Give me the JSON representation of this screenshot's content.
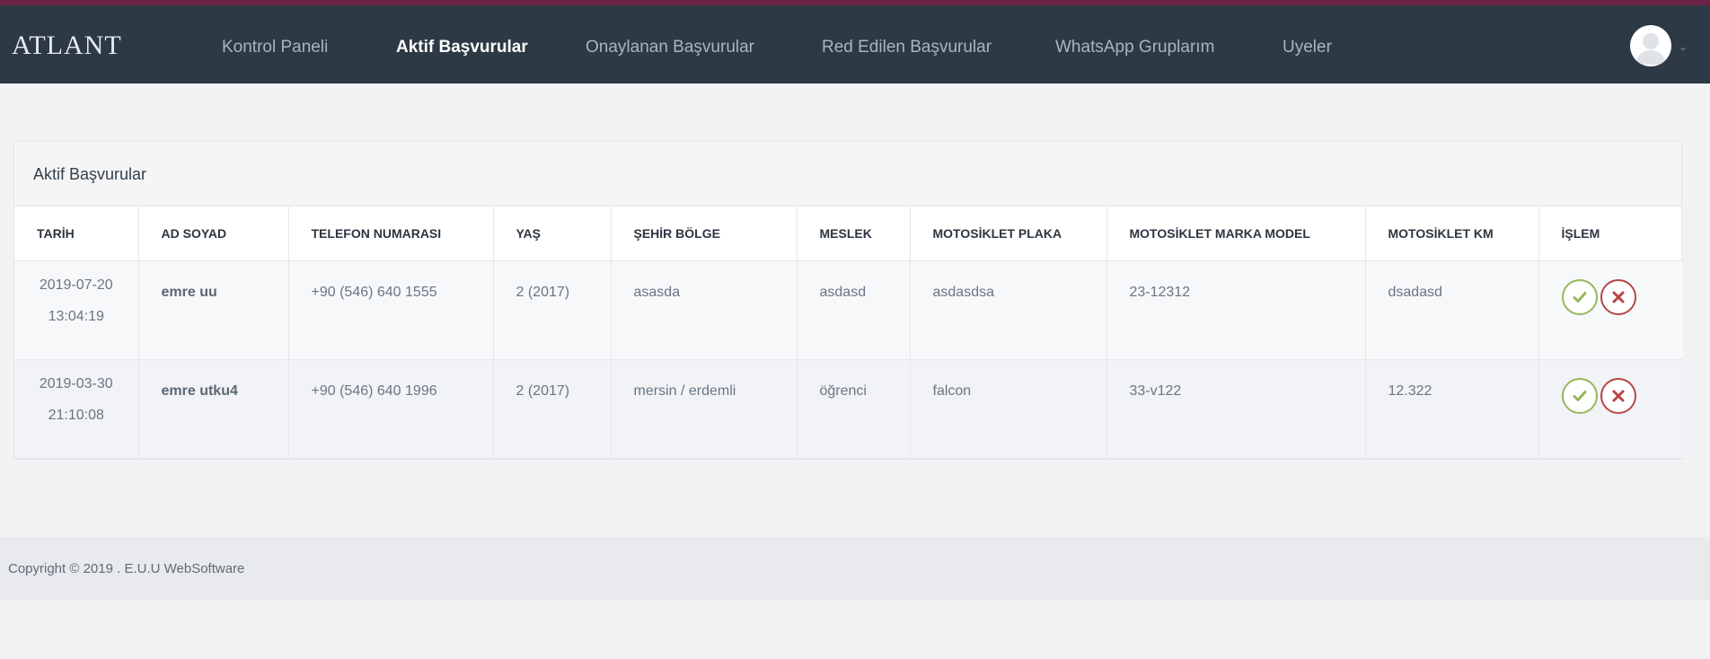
{
  "app": {
    "logo": "ATLANT"
  },
  "nav": {
    "items": [
      {
        "label": "Kontrol Paneli",
        "active": false
      },
      {
        "label": "Aktif Başvurular",
        "active": true
      },
      {
        "label": "Onaylanan Başvurular",
        "active": false
      },
      {
        "label": "Red Edilen Başvurular",
        "active": false
      },
      {
        "label": "WhatsApp Gruplarım",
        "active": false
      },
      {
        "label": "Uyeler",
        "active": false
      }
    ]
  },
  "user_menu": {
    "avatar_icon": "user-avatar-icon",
    "caret_icon": "chevron-down-icon"
  },
  "panel": {
    "title": "Aktif Başvurular",
    "columns": [
      "TARİH",
      "AD SOYAD",
      "TELEFON NUMARASI",
      "YAŞ",
      "ŞEHİR BÖLGE",
      "MESLEK",
      "MOTOSİKLET PLAKA",
      "MOTOSİKLET MARKA MODEL",
      "MOTOSİKLET KM",
      "İŞLEM"
    ],
    "rows": [
      {
        "date": "2019-07-20",
        "time": "13:04:19",
        "name": "emre uu",
        "phone": "+90 (546) 640 1555",
        "age": "2 (2017)",
        "city": "asasda",
        "job": "asdasd",
        "plate": "asdasdsa",
        "model": "23-12312",
        "km": "dsadasd"
      },
      {
        "date": "2019-03-30",
        "time": "21:10:08",
        "name": "emre utku4",
        "phone": "+90 (546) 640 1996",
        "age": "2 (2017)",
        "city": "mersin / erdemli",
        "job": "öğrenci",
        "plate": "falcon",
        "model": "33-v122",
        "km": "12.322"
      }
    ],
    "actions": {
      "approve_icon": "check-icon",
      "reject_icon": "close-icon"
    }
  },
  "colors": {
    "topbar": "#2d3945",
    "topbar_accent": "#6b2346",
    "approve": "#95b75d",
    "reject": "#b64645"
  },
  "footer": {
    "copyright": "Copyright © 2019 . E.U.U WebSoftware"
  }
}
